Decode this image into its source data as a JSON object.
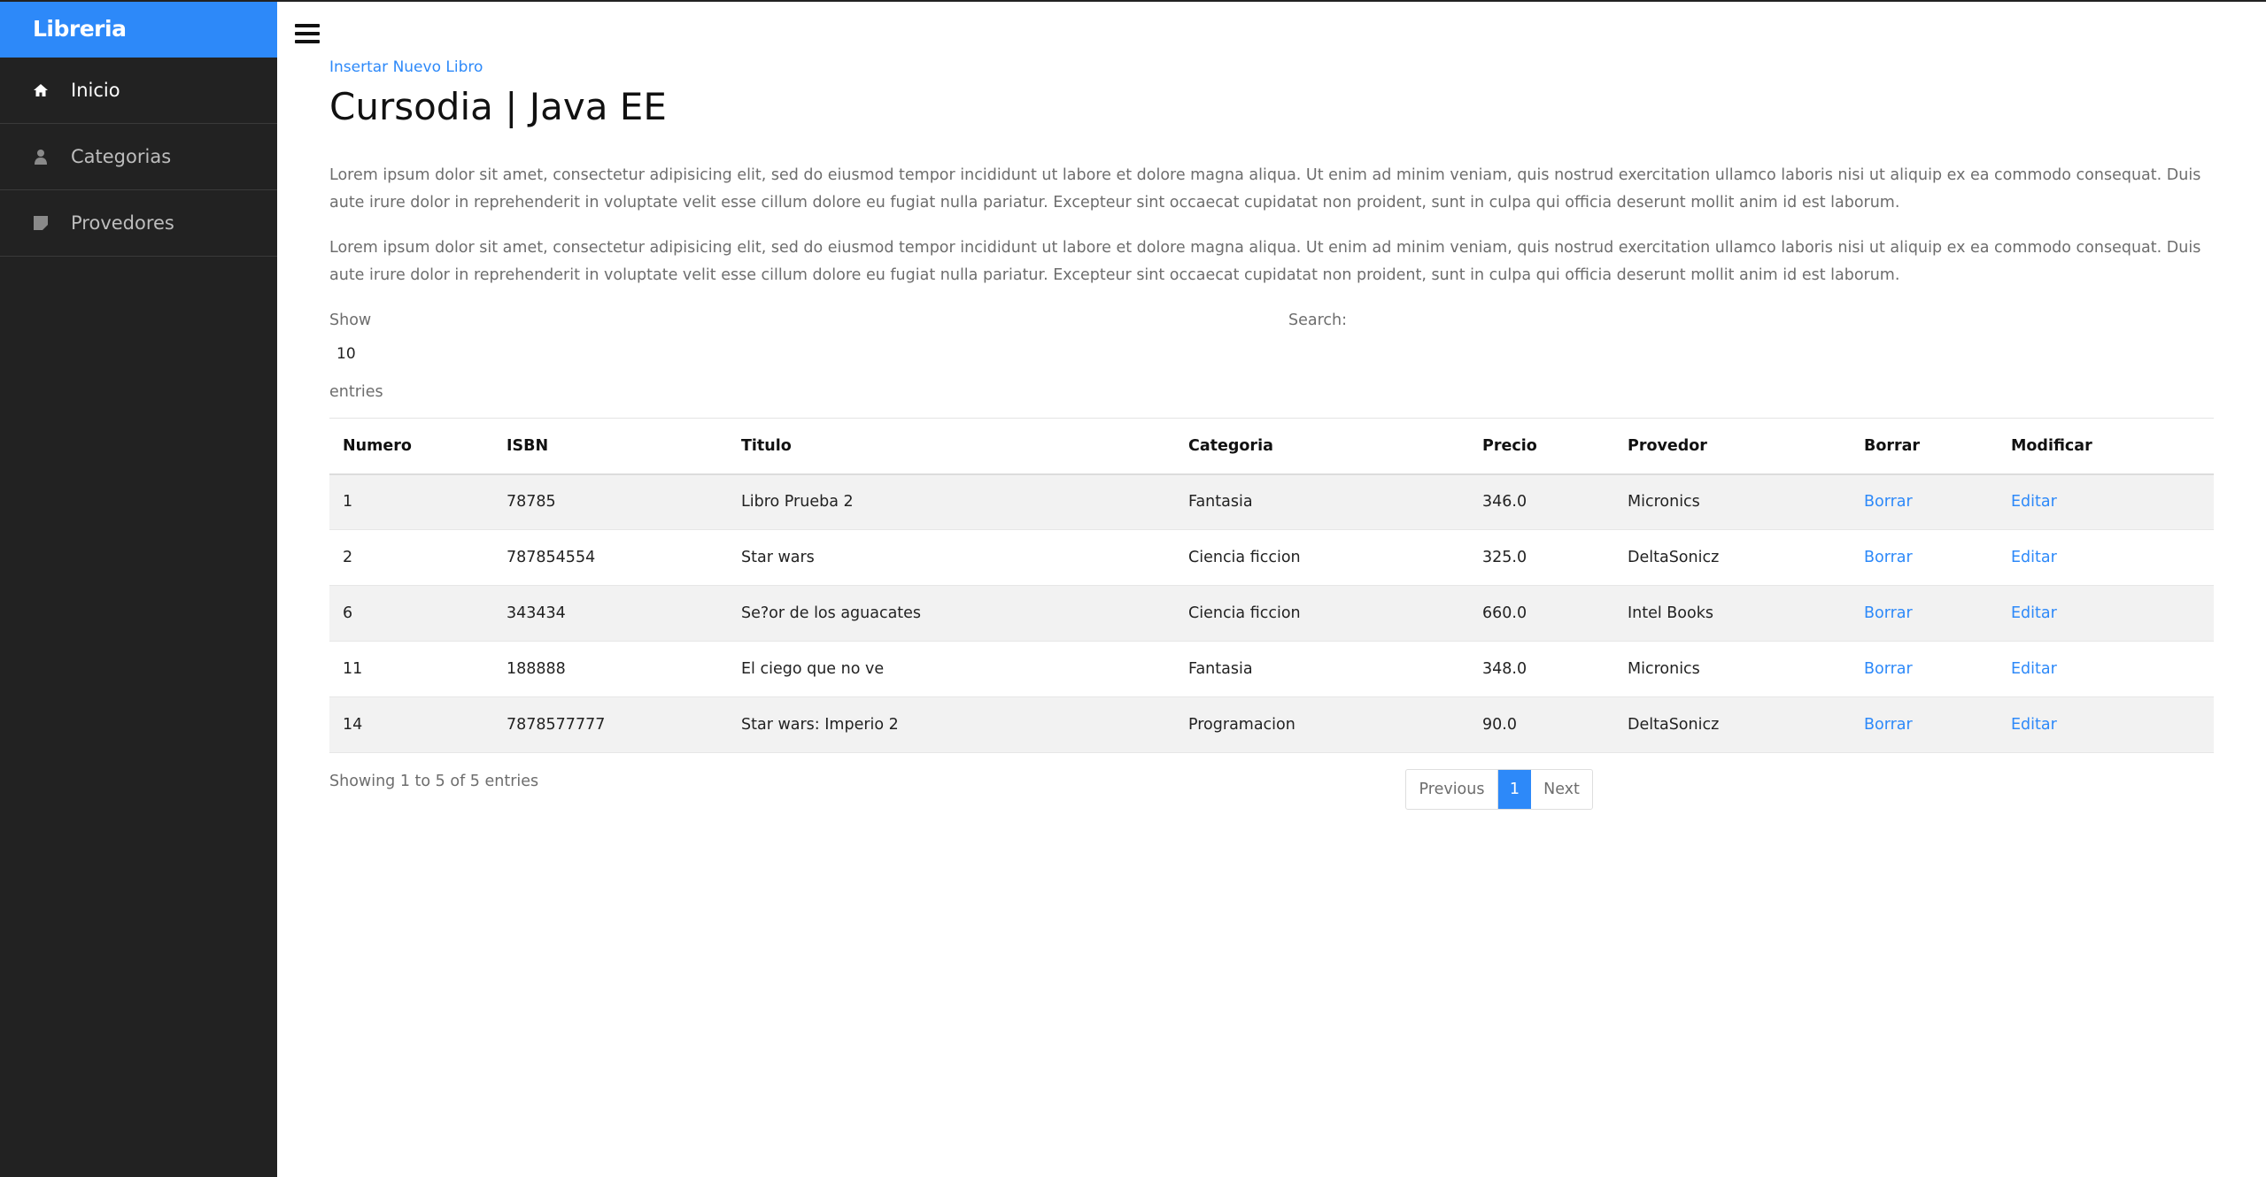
{
  "sidebar": {
    "brand": "Libreria",
    "items": [
      {
        "label": "Inicio",
        "icon": "home-icon",
        "active": true
      },
      {
        "label": "Categorias",
        "icon": "user-icon",
        "active": false
      },
      {
        "label": "Provedores",
        "icon": "note-icon",
        "active": false
      }
    ]
  },
  "main": {
    "insert_link": "Insertar Nuevo Libro",
    "title": "Cursodia | Java EE",
    "paragraphs": [
      "Lorem ipsum dolor sit amet, consectetur adipisicing elit, sed do eiusmod tempor incididunt ut labore et dolore magna aliqua. Ut enim ad minim veniam, quis nostrud exercitation ullamco laboris nisi ut aliquip ex ea commodo consequat. Duis aute irure dolor in reprehenderit in voluptate velit esse cillum dolore eu fugiat nulla pariatur. Excepteur sint occaecat cupidatat non proident, sunt in culpa qui officia deserunt mollit anim id est laborum.",
      "Lorem ipsum dolor sit amet, consectetur adipisicing elit, sed do eiusmod tempor incididunt ut labore et dolore magna aliqua. Ut enim ad minim veniam, quis nostrud exercitation ullamco laboris nisi ut aliquip ex ea commodo consequat. Duis aute irure dolor in reprehenderit in voluptate velit esse cillum dolore eu fugiat nulla pariatur. Excepteur sint occaecat cupidatat non proident, sunt in culpa qui officia deserunt mollit anim id est laborum."
    ]
  },
  "datatable": {
    "show_label": "Show",
    "length_value": "10",
    "entries_label": "entries",
    "search_label": "Search:",
    "search_value": "",
    "columns": [
      "Numero",
      "ISBN",
      "Titulo",
      "Categoria",
      "Precio",
      "Provedor",
      "Borrar",
      "Modificar"
    ],
    "rows": [
      {
        "numero": "1",
        "isbn": "78785",
        "titulo": "Libro Prueba 2",
        "categoria": "Fantasia",
        "precio": "346.0",
        "provedor": "Micronics",
        "borrar": "Borrar",
        "modificar": "Editar"
      },
      {
        "numero": "2",
        "isbn": "787854554",
        "titulo": "Star wars",
        "categoria": "Ciencia ficcion",
        "precio": "325.0",
        "provedor": "DeltaSonicz",
        "borrar": "Borrar",
        "modificar": "Editar"
      },
      {
        "numero": "6",
        "isbn": "343434",
        "titulo": "Se?or de los aguacates",
        "categoria": "Ciencia ficcion",
        "precio": "660.0",
        "provedor": "Intel Books",
        "borrar": "Borrar",
        "modificar": "Editar"
      },
      {
        "numero": "11",
        "isbn": "188888",
        "titulo": "El ciego que no ve",
        "categoria": "Fantasia",
        "precio": "348.0",
        "provedor": "Micronics",
        "borrar": "Borrar",
        "modificar": "Editar"
      },
      {
        "numero": "14",
        "isbn": "7878577777",
        "titulo": "Star wars: Imperio 2",
        "categoria": "Programacion",
        "precio": "90.0",
        "provedor": "DeltaSonicz",
        "borrar": "Borrar",
        "modificar": "Editar"
      }
    ],
    "info": "Showing 1 to 5 of 5 entries",
    "pagination": {
      "previous": "Previous",
      "current": "1",
      "next": "Next"
    }
  },
  "colors": {
    "accent": "#2d89f9",
    "sidebar_bg": "#222222",
    "row_stripe": "#f2f2f2"
  }
}
